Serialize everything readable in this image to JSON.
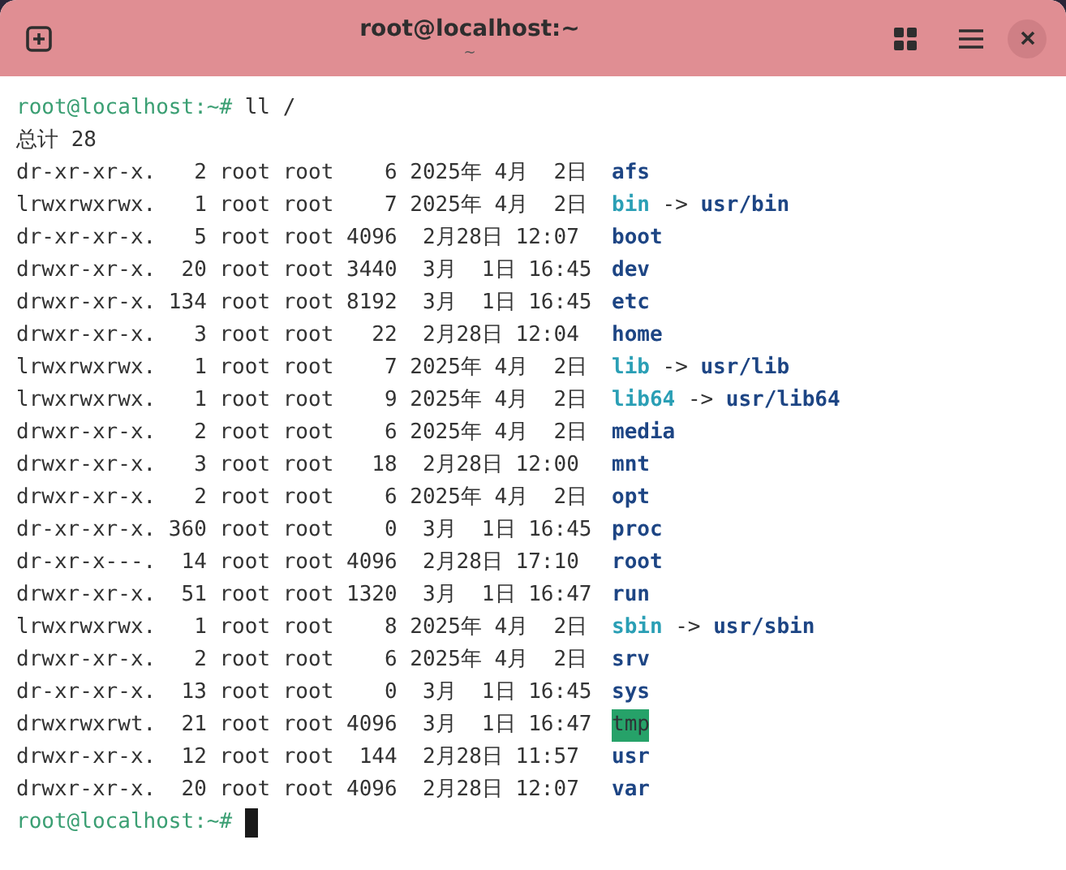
{
  "window": {
    "title": "root@localhost:~",
    "subtitle": "~"
  },
  "terminal": {
    "lines": [
      {
        "kind": "prompt",
        "prompt": "root@localhost:~#",
        "command": "ll /"
      },
      {
        "kind": "text",
        "text": "总计 28"
      },
      {
        "kind": "entry",
        "meta": "dr-xr-xr-x.   2 root root    6 2025年 4月  2日",
        "file": {
          "name": "afs",
          "kind": "dir"
        }
      },
      {
        "kind": "entry",
        "meta": "lrwxrwxrwx.   1 root root    7 2025年 4月  2日",
        "file": {
          "name": "bin",
          "kind": "link"
        },
        "arrow": "->",
        "target": "usr/bin"
      },
      {
        "kind": "entry",
        "meta": "dr-xr-xr-x.   5 root root 4096  2月28日 12:07",
        "file": {
          "name": "boot",
          "kind": "dir"
        }
      },
      {
        "kind": "entry",
        "meta": "drwxr-xr-x.  20 root root 3440  3月  1日 16:45",
        "file": {
          "name": "dev",
          "kind": "dir"
        }
      },
      {
        "kind": "entry",
        "meta": "drwxr-xr-x. 134 root root 8192  3月  1日 16:45",
        "file": {
          "name": "etc",
          "kind": "dir"
        }
      },
      {
        "kind": "entry",
        "meta": "drwxr-xr-x.   3 root root   22  2月28日 12:04",
        "file": {
          "name": "home",
          "kind": "dir"
        }
      },
      {
        "kind": "entry",
        "meta": "lrwxrwxrwx.   1 root root    7 2025年 4月  2日",
        "file": {
          "name": "lib",
          "kind": "link"
        },
        "arrow": "->",
        "target": "usr/lib"
      },
      {
        "kind": "entry",
        "meta": "lrwxrwxrwx.   1 root root    9 2025年 4月  2日",
        "file": {
          "name": "lib64",
          "kind": "link"
        },
        "arrow": "->",
        "target": "usr/lib64"
      },
      {
        "kind": "entry",
        "meta": "drwxr-xr-x.   2 root root    6 2025年 4月  2日",
        "file": {
          "name": "media",
          "kind": "dir"
        }
      },
      {
        "kind": "entry",
        "meta": "drwxr-xr-x.   3 root root   18  2月28日 12:00",
        "file": {
          "name": "mnt",
          "kind": "dir"
        }
      },
      {
        "kind": "entry",
        "meta": "drwxr-xr-x.   2 root root    6 2025年 4月  2日",
        "file": {
          "name": "opt",
          "kind": "dir"
        }
      },
      {
        "kind": "entry",
        "meta": "dr-xr-xr-x. 360 root root    0  3月  1日 16:45",
        "file": {
          "name": "proc",
          "kind": "dir"
        }
      },
      {
        "kind": "entry",
        "meta": "dr-xr-x---.  14 root root 4096  2月28日 17:10",
        "file": {
          "name": "root",
          "kind": "dir"
        }
      },
      {
        "kind": "entry",
        "meta": "drwxr-xr-x.  51 root root 1320  3月  1日 16:47",
        "file": {
          "name": "run",
          "kind": "dir"
        }
      },
      {
        "kind": "entry",
        "meta": "lrwxrwxrwx.   1 root root    8 2025年 4月  2日",
        "file": {
          "name": "sbin",
          "kind": "link"
        },
        "arrow": "->",
        "target": "usr/sbin"
      },
      {
        "kind": "entry",
        "meta": "drwxr-xr-x.   2 root root    6 2025年 4月  2日",
        "file": {
          "name": "srv",
          "kind": "dir"
        }
      },
      {
        "kind": "entry",
        "meta": "dr-xr-xr-x.  13 root root    0  3月  1日 16:45",
        "file": {
          "name": "sys",
          "kind": "dir"
        }
      },
      {
        "kind": "entry",
        "meta": "drwxrwxrwt.  21 root root 4096  3月  1日 16:47",
        "file": {
          "name": "tmp",
          "kind": "sticky"
        }
      },
      {
        "kind": "entry",
        "meta": "drwxr-xr-x.  12 root root  144  2月28日 11:57",
        "file": {
          "name": "usr",
          "kind": "dir"
        }
      },
      {
        "kind": "entry",
        "meta": "drwxr-xr-x.  20 root root 4096  2月28日 12:07",
        "file": {
          "name": "var",
          "kind": "dir"
        }
      },
      {
        "kind": "prompt",
        "prompt": "root@localhost:~#",
        "cursor": true
      }
    ]
  }
}
